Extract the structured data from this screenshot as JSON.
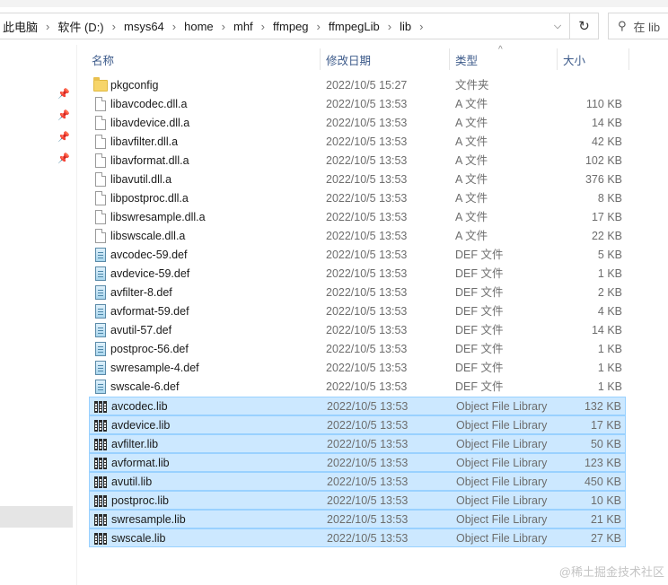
{
  "breadcrumb": [
    "此电脑",
    "软件 (D:)",
    "msys64",
    "home",
    "mhf",
    "ffmpeg",
    "ffmpegLib",
    "lib"
  ],
  "search": {
    "placeholder": "在 lib"
  },
  "columns": {
    "name": "名称",
    "date": "修改日期",
    "type": "类型",
    "size": "大小"
  },
  "files": [
    {
      "name": "pkgconfig",
      "date": "2022/10/5 15:27",
      "type": "文件夹",
      "size": "",
      "icon": "folder-icon",
      "selected": false
    },
    {
      "name": "libavcodec.dll.a",
      "date": "2022/10/5 13:53",
      "type": "A 文件",
      "size": "110 KB",
      "icon": "file-icon",
      "selected": false
    },
    {
      "name": "libavdevice.dll.a",
      "date": "2022/10/5 13:53",
      "type": "A 文件",
      "size": "14 KB",
      "icon": "file-icon",
      "selected": false
    },
    {
      "name": "libavfilter.dll.a",
      "date": "2022/10/5 13:53",
      "type": "A 文件",
      "size": "42 KB",
      "icon": "file-icon",
      "selected": false
    },
    {
      "name": "libavformat.dll.a",
      "date": "2022/10/5 13:53",
      "type": "A 文件",
      "size": "102 KB",
      "icon": "file-icon",
      "selected": false
    },
    {
      "name": "libavutil.dll.a",
      "date": "2022/10/5 13:53",
      "type": "A 文件",
      "size": "376 KB",
      "icon": "file-icon",
      "selected": false
    },
    {
      "name": "libpostproc.dll.a",
      "date": "2022/10/5 13:53",
      "type": "A 文件",
      "size": "8 KB",
      "icon": "file-icon",
      "selected": false
    },
    {
      "name": "libswresample.dll.a",
      "date": "2022/10/5 13:53",
      "type": "A 文件",
      "size": "17 KB",
      "icon": "file-icon",
      "selected": false
    },
    {
      "name": "libswscale.dll.a",
      "date": "2022/10/5 13:53",
      "type": "A 文件",
      "size": "22 KB",
      "icon": "file-icon",
      "selected": false
    },
    {
      "name": "avcodec-59.def",
      "date": "2022/10/5 13:53",
      "type": "DEF 文件",
      "size": "5 KB",
      "icon": "def-file-icon",
      "selected": false
    },
    {
      "name": "avdevice-59.def",
      "date": "2022/10/5 13:53",
      "type": "DEF 文件",
      "size": "1 KB",
      "icon": "def-file-icon",
      "selected": false
    },
    {
      "name": "avfilter-8.def",
      "date": "2022/10/5 13:53",
      "type": "DEF 文件",
      "size": "2 KB",
      "icon": "def-file-icon",
      "selected": false
    },
    {
      "name": "avformat-59.def",
      "date": "2022/10/5 13:53",
      "type": "DEF 文件",
      "size": "4 KB",
      "icon": "def-file-icon",
      "selected": false
    },
    {
      "name": "avutil-57.def",
      "date": "2022/10/5 13:53",
      "type": "DEF 文件",
      "size": "14 KB",
      "icon": "def-file-icon",
      "selected": false
    },
    {
      "name": "postproc-56.def",
      "date": "2022/10/5 13:53",
      "type": "DEF 文件",
      "size": "1 KB",
      "icon": "def-file-icon",
      "selected": false
    },
    {
      "name": "swresample-4.def",
      "date": "2022/10/5 13:53",
      "type": "DEF 文件",
      "size": "1 KB",
      "icon": "def-file-icon",
      "selected": false
    },
    {
      "name": "swscale-6.def",
      "date": "2022/10/5 13:53",
      "type": "DEF 文件",
      "size": "1 KB",
      "icon": "def-file-icon",
      "selected": false
    },
    {
      "name": "avcodec.lib",
      "date": "2022/10/5 13:53",
      "type": "Object File Library",
      "size": "132 KB",
      "icon": "lib-file-icon",
      "selected": true
    },
    {
      "name": "avdevice.lib",
      "date": "2022/10/5 13:53",
      "type": "Object File Library",
      "size": "17 KB",
      "icon": "lib-file-icon",
      "selected": true
    },
    {
      "name": "avfilter.lib",
      "date": "2022/10/5 13:53",
      "type": "Object File Library",
      "size": "50 KB",
      "icon": "lib-file-icon",
      "selected": true
    },
    {
      "name": "avformat.lib",
      "date": "2022/10/5 13:53",
      "type": "Object File Library",
      "size": "123 KB",
      "icon": "lib-file-icon",
      "selected": true
    },
    {
      "name": "avutil.lib",
      "date": "2022/10/5 13:53",
      "type": "Object File Library",
      "size": "450 KB",
      "icon": "lib-file-icon",
      "selected": true
    },
    {
      "name": "postproc.lib",
      "date": "2022/10/5 13:53",
      "type": "Object File Library",
      "size": "10 KB",
      "icon": "lib-file-icon",
      "selected": true
    },
    {
      "name": "swresample.lib",
      "date": "2022/10/5 13:53",
      "type": "Object File Library",
      "size": "21 KB",
      "icon": "lib-file-icon",
      "selected": true
    },
    {
      "name": "swscale.lib",
      "date": "2022/10/5 13:53",
      "type": "Object File Library",
      "size": "27 KB",
      "icon": "lib-file-icon",
      "selected": true
    }
  ],
  "watermark": "@稀土掘金技术社区"
}
